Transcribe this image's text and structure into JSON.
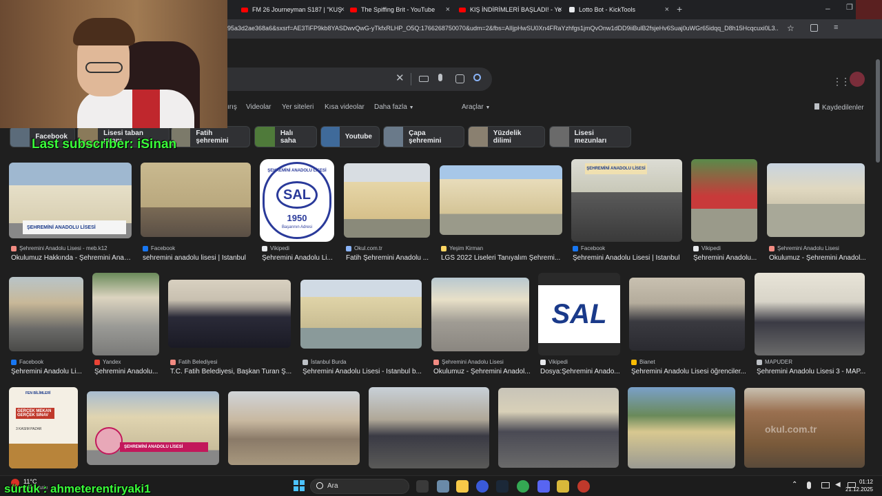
{
  "tabs": [
    {
      "title": "FM 26 Journeyman S187 | \"KUŞ",
      "color": "#ff0000"
    },
    {
      "title": "The Spiffing Brit - YouTube",
      "color": "#ff0000"
    },
    {
      "title": "KIŞ İNDİRİMLERİ BAŞLADI! - Ye",
      "color": "#ff0000"
    },
    {
      "title": "Lotto Bot - KickTools",
      "color": "#e8eaed"
    }
  ],
  "address": {
    "url": "95a3d2ae368a6&sxsrf=AE3TiFP9kb8YASDwvQwG-yTkfxRLHP_O5Q:1766268750070&udm=2&fbs=AIIjpHwSU0Xn4FRaYzhfgs1jmQvOnw1dDD9iiBulB2fsjeHv6Suaj0uWGr65idqq_D8h15Hcqcuxi0L3..."
  },
  "filters": {
    "items": [
      "ırış",
      "Videolar",
      "Yer siteleri",
      "Kısa videolar",
      "Daha fazla"
    ],
    "tools": "Araçlar",
    "saved": "Kaydedilenler"
  },
  "chips": [
    "Facebook",
    "Lisesi taban puanı",
    "Fatih şehremini",
    "Halı saha",
    "Youtube",
    "Çapa şehremini",
    "Yüzdelik dilimi",
    "Lisesi mezunları"
  ],
  "overlay": {
    "last_sub": "Last subscriber: iSinan",
    "sub_line": "sürtük : ahmeterentiryaki1"
  },
  "row1": [
    {
      "src": "Şehremini Anadolu Lisesi - meb.k12",
      "title": "Okulumuz Hakkında - Şehremini Anad...",
      "src_color": "#f28b82"
    },
    {
      "src": "Facebook",
      "title": "sehremini anadolu lisesi | Istanbul",
      "src_color": "#1877f2"
    },
    {
      "src": "Vikipedi",
      "title": "Şehremini Anadolu Li...",
      "src_color": "#e8eaed"
    },
    {
      "src": "Okul.com.tr",
      "title": "Fatih Şehremini Anadolu ...",
      "src_color": "#8ab4f8"
    },
    {
      "src": "Yeşim Kirman",
      "title": "LGS 2022 Liseleri Tanıyalım Şehremi...",
      "src_color": "#fdd663"
    },
    {
      "src": "Facebook",
      "title": "Şehremini Anadolu Lisesi | Istanbul",
      "src_color": "#1877f2"
    },
    {
      "src": "Vikipedi",
      "title": "Şehremini Anadolu...",
      "src_color": "#e8eaed"
    },
    {
      "src": "Şehremini Anadolu Lisesi",
      "title": "Okulumuz - Şehremini Anadol...",
      "src_color": "#f28b82"
    }
  ],
  "row2": [
    {
      "src": "Facebook",
      "title": "Şehremini Anadolu Li...",
      "src_color": "#1877f2"
    },
    {
      "src": "Yandex",
      "title": "Şehremini Anadolu...",
      "src_color": "#ea4335"
    },
    {
      "src": "Fatih Belediyesi",
      "title": "T.C. Fatih Belediyesi, Başkan Turan Ş...",
      "src_color": "#f28b82"
    },
    {
      "src": "İstanbul Burda",
      "title": "Şehremini Anadolu Lisesi - İstanbul b...",
      "src_color": "#bdc1c6"
    },
    {
      "src": "Şehremini Anadolu Lisesi",
      "title": "Okulumuz - Şehremini Anadol...",
      "src_color": "#f28b82"
    },
    {
      "src": "Vikipedi",
      "title": "Dosya:Şehremini Anado...",
      "src_color": "#e8eaed"
    },
    {
      "src": "Bianet",
      "title": "Şehremini Anadolu Lisesi öğrenciler...",
      "src_color": "#fbbc04"
    },
    {
      "src": "MAPUDER",
      "title": "Şehremini Anadolu Lisesi 3 - MAP...",
      "src_color": "#bdc1c6"
    }
  ],
  "images": {
    "sal_text": "ŞEHREMİNİ ANADOLU LİSESİ",
    "logo_year": "1950",
    "logo_motto": "Başarının Adresi",
    "logo_ring": "ŞEHREMİNİ ANADOLU LİSESİ",
    "sal_short": "SAL",
    "promo_title": "GERÇEK MEKAN GERÇEK SINAV",
    "promo_header": "FEN BİLİMLERİ",
    "promo_date": "3 KASIM PAZAR",
    "video_banner": "ŞEHREMİNİ ANADOLU LİSESİ",
    "watermark": "okul.com.tr"
  },
  "taskbar": {
    "weather": "11°C",
    "weather_sub": "Çok bulutlu",
    "search": "Ara",
    "time": "01:12",
    "date": "21.12.2025"
  },
  "colors": {
    "bg": "#1f1f1f",
    "chrome": "#202124",
    "accent": "#8ab4f8"
  }
}
